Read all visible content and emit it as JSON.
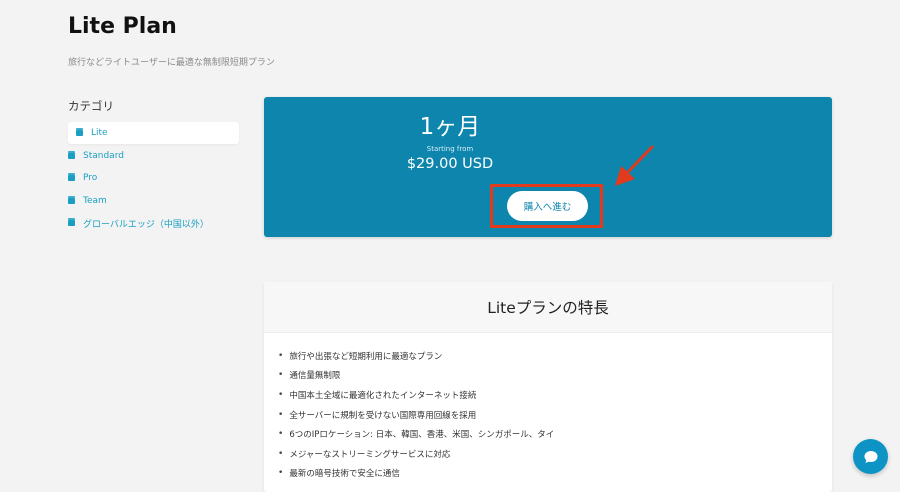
{
  "page": {
    "title": "Lite Plan",
    "subtitle": "旅行などライトユーザーに最適な無制限短期プラン"
  },
  "sidebar": {
    "heading": "カテゴリ",
    "items": [
      {
        "label": "Lite",
        "active": true
      },
      {
        "label": "Standard",
        "active": false
      },
      {
        "label": "Pro",
        "active": false
      },
      {
        "label": "Team",
        "active": false
      },
      {
        "label": "グローバルエッジ（中国以外）",
        "active": false
      }
    ]
  },
  "plan": {
    "name": "1ヶ月",
    "starting_label": "Starting from",
    "price": "$29.00 USD",
    "button_label": "購入へ進む"
  },
  "features": {
    "title": "Liteプランの特長",
    "items": [
      "旅行や出張など短期利用に最適なプラン",
      "通信量無制限",
      "中国本土全域に最適化されたインターネット接続",
      "全サーバーに規制を受けない国際専用回線を採用",
      "6つのIPロケーション: 日本、韓国、香港、米国、シンガポール、タイ",
      "メジャーなストリーミングサービスに対応",
      "最新の暗号技術で安全に通信"
    ]
  },
  "colors": {
    "accent": "#0d85ad",
    "link": "#1a9fc2",
    "highlight": "#e23a1c",
    "chat": "#0d94c5"
  },
  "icons": {
    "category": "box-icon",
    "annotation": "arrow-icon",
    "chat": "chat-bubble-icon"
  }
}
